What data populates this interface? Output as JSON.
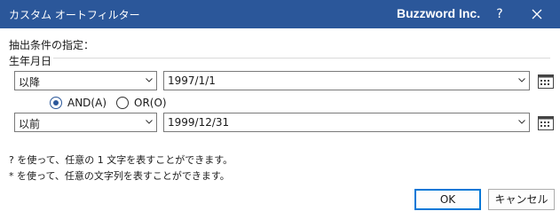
{
  "window": {
    "title": "カスタム オートフィルター",
    "brand": "Buzzword Inc.",
    "help": "?"
  },
  "criteria": {
    "heading": "抽出条件の指定：",
    "field_name": "生年月日"
  },
  "condition1": {
    "operator": "以降",
    "value": "1997/1/1"
  },
  "logic": {
    "and_label": "AND(A)",
    "or_label": "OR(O)",
    "selected": "AND"
  },
  "condition2": {
    "operator": "以前",
    "value": "1999/12/31"
  },
  "hints": {
    "line1": "? を使って、任意の 1 文字を表すことができます。",
    "line2": "* を使って、任意の文字列を表すことができます。"
  },
  "buttons": {
    "ok": "OK",
    "cancel": "キャンセル"
  },
  "colors": {
    "titlebar": "#2b579a",
    "accent": "#0078d7"
  },
  "icons": {
    "close": "close-icon",
    "calendar": "calendar-icon",
    "dropdown": "chevron-down-icon"
  }
}
